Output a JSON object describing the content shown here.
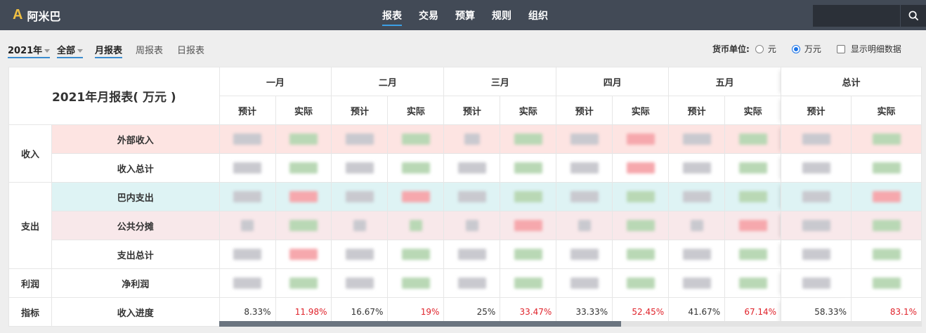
{
  "app": {
    "name": "阿米巴",
    "logo": "A"
  },
  "nav": [
    "报表",
    "交易",
    "预算",
    "规则",
    "组织"
  ],
  "filters": {
    "year": "2021年",
    "scope": "全部",
    "tabs": [
      "月报表",
      "周报表",
      "日报表"
    ]
  },
  "currency": {
    "label": "货币单位:",
    "options": [
      "元",
      "万元"
    ],
    "selected": "万元",
    "detail_label": "显示明细数据"
  },
  "table": {
    "title": "2021年月报表( 万元 )",
    "months": [
      "一月",
      "二月",
      "三月",
      "四月",
      "五月"
    ],
    "total_label": "总计",
    "sub_headers": [
      "预计",
      "实际"
    ],
    "categories": {
      "income": "收入",
      "expense": "支出",
      "profit": "利润",
      "metric": "指标"
    },
    "rows": {
      "external_income": "外部收入",
      "income_total": "收入总计",
      "internal_expense": "巴内支出",
      "public_share": "公共分摊",
      "expense_total": "支出总计",
      "net_profit": "净利润",
      "income_progress": "收入进度"
    },
    "progress": {
      "planned": [
        "8.33%",
        "16.67%",
        "25%",
        "33.33%",
        "41.67%",
        "58.33%"
      ],
      "actual": [
        "11.98%",
        "19%",
        "33.47%",
        "52.45%",
        "67.14%",
        "83.1%"
      ]
    }
  },
  "colors": {
    "topbar": "#424a56",
    "accent": "#3ca0e6",
    "income_row": "#fde4e2",
    "inner_expense_row": "#def3f4",
    "share_row": "#f8e8ea",
    "negative_text": "#e0232b"
  }
}
